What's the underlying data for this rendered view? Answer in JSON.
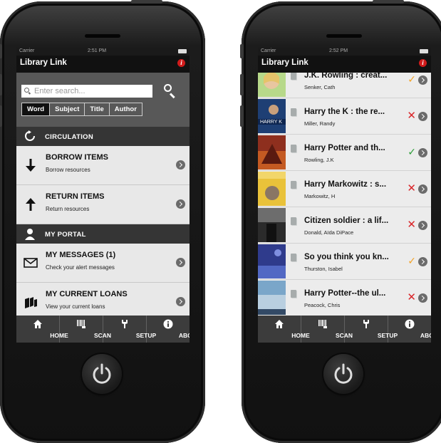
{
  "left_phone": {
    "status": {
      "carrier": "Carrier",
      "time": "2:51 PM"
    },
    "nav_title": "Library Link",
    "search": {
      "placeholder": "Enter search..."
    },
    "segments": [
      {
        "label": "Word",
        "active": true
      },
      {
        "label": "Subject",
        "active": false
      },
      {
        "label": "Title",
        "active": false
      },
      {
        "label": "Author",
        "active": false
      }
    ],
    "circulation": {
      "header": "CIRCULATION",
      "items": [
        {
          "title": "BORROW ITEMS",
          "subtitle": "Borrow resources",
          "icon": "arrow-down-icon"
        },
        {
          "title": "RETURN ITEMS",
          "subtitle": "Return resources",
          "icon": "arrow-up-icon"
        }
      ]
    },
    "portal": {
      "header": "MY PORTAL",
      "items": [
        {
          "title": "MY MESSAGES (1)",
          "subtitle": "Check your alert messages",
          "icon": "envelope-icon"
        },
        {
          "title": "MY CURRENT LOANS",
          "subtitle": "View your current loans",
          "icon": "books-icon"
        }
      ]
    }
  },
  "right_phone": {
    "status": {
      "carrier": "Carrier",
      "time": "2:52 PM"
    },
    "nav_title": "Library Link",
    "books": [
      {
        "title": "J.K. Rowling : creat...",
        "author": "Senker, Cath",
        "status": "check-orange"
      },
      {
        "title": "Harry the K : the re...",
        "author": "Miller, Randy",
        "status": "cross"
      },
      {
        "title": "Harry Potter and th...",
        "author": "Rowling, J.K",
        "status": "check-green"
      },
      {
        "title": "Harry Markowitz : s...",
        "author": "Markowitz, H",
        "status": "cross"
      },
      {
        "title": "Citizen soldier : a lif...",
        "author": "Donald, Aïda DiPace",
        "status": "cross"
      },
      {
        "title": "So you think you kn...",
        "author": "Thurston, Isabel",
        "status": "check-orange"
      },
      {
        "title": "Harry Potter--the ul...",
        "author": "Peacock, Chris",
        "status": "cross"
      }
    ]
  },
  "tabs": [
    {
      "label": "HOME",
      "icon": "home-icon"
    },
    {
      "label": "SCAN",
      "icon": "barcode-icon"
    },
    {
      "label": "SETUP",
      "icon": "wrench-icon"
    },
    {
      "label": "ABOUT",
      "icon": "info-icon"
    }
  ],
  "colors": {
    "nav_bg": "#111111",
    "section_bg": "#353535",
    "search_bg": "#585858",
    "row_bg": "#e8e8e8",
    "tabbar_bg": "#3c3c3c",
    "alert_red": "#d01b1b",
    "check_green": "#2a9d36",
    "check_orange": "#f3a327",
    "cross_red": "#d9262a"
  }
}
